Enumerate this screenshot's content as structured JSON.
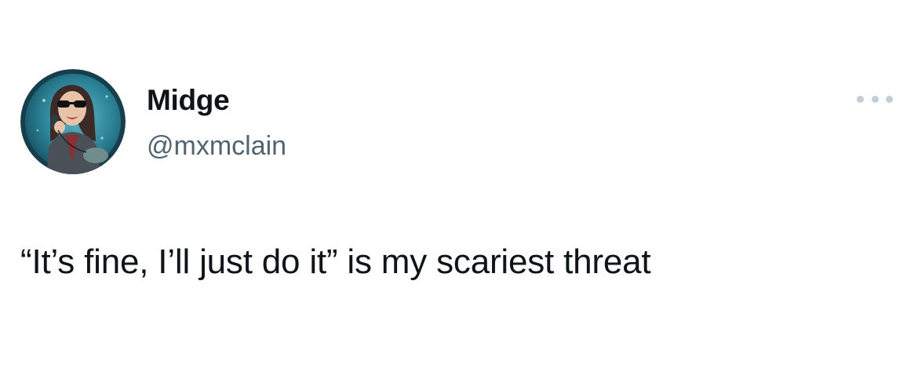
{
  "tweet": {
    "author": {
      "display_name": "Midge",
      "handle": "@mxmclain",
      "avatar_icon": "user-avatar-photo"
    },
    "text": "“It’s fine, I’ll just do it” is my scariest threat",
    "more_icon": "more-options-icon"
  },
  "colors": {
    "text_primary": "#0f1419",
    "text_secondary": "#536471",
    "more_dots": "#c4cdd4",
    "avatar_ring": "#1c4a5a"
  }
}
